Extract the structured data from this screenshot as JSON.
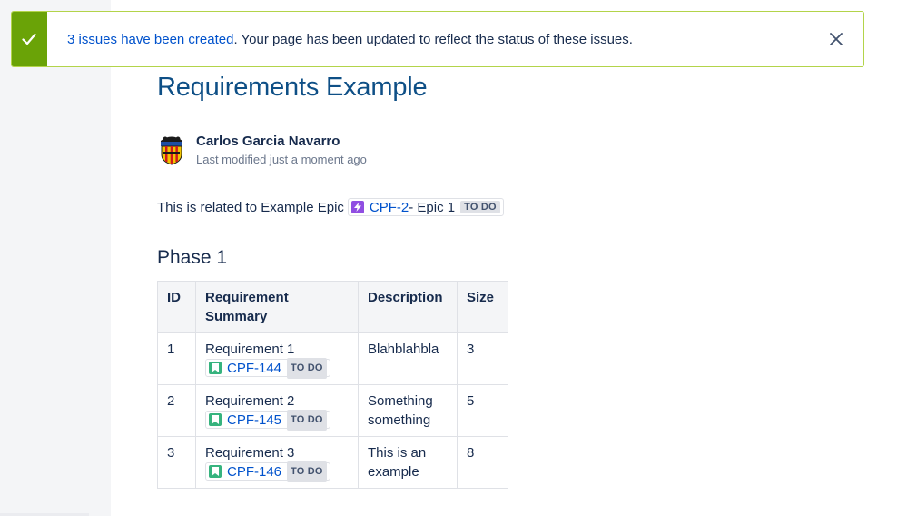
{
  "flag": {
    "link_text": "3 issues have been created",
    "message": ". Your page has been updated to reflect the status of these issues.",
    "success_color": "#6aa307",
    "icons": {
      "status": "check-icon",
      "close": "close-icon"
    }
  },
  "page": {
    "title": "Requirements Example",
    "title_color": "#0e4f86"
  },
  "byline": {
    "author": "Carlos Garcia Navarro",
    "meta": "Last modified just a moment ago"
  },
  "related": {
    "prefix": "This is related to Example Epic",
    "epic": {
      "key": "CPF-2",
      "summary": " - Epic 1",
      "status": "TO DO",
      "icon": "epic-lightning-icon",
      "icon_color": "#904ee2"
    }
  },
  "section": {
    "heading": "Phase 1"
  },
  "table": {
    "headers": {
      "id": "ID",
      "summary_line1": "Requirement",
      "summary_line2": "Summary",
      "description": "Description",
      "size": "Size"
    },
    "rows": [
      {
        "id": "1",
        "summary": "Requirement 1",
        "key": "CPF-144",
        "status": "TO DO",
        "description_line1": "Blahblahbla",
        "description_line2": "",
        "size": "3"
      },
      {
        "id": "2",
        "summary": "Requirement 2",
        "key": "CPF-145",
        "status": "TO DO",
        "description_line1": "Something",
        "description_line2": "something",
        "size": "5"
      },
      {
        "id": "3",
        "summary": "Requirement 3",
        "key": "CPF-146",
        "status": "TO DO",
        "description_line1": "This is an",
        "description_line2": "example",
        "size": "8"
      }
    ],
    "story_icon": "story-bookmark-icon",
    "story_icon_color": "#36b37e"
  }
}
